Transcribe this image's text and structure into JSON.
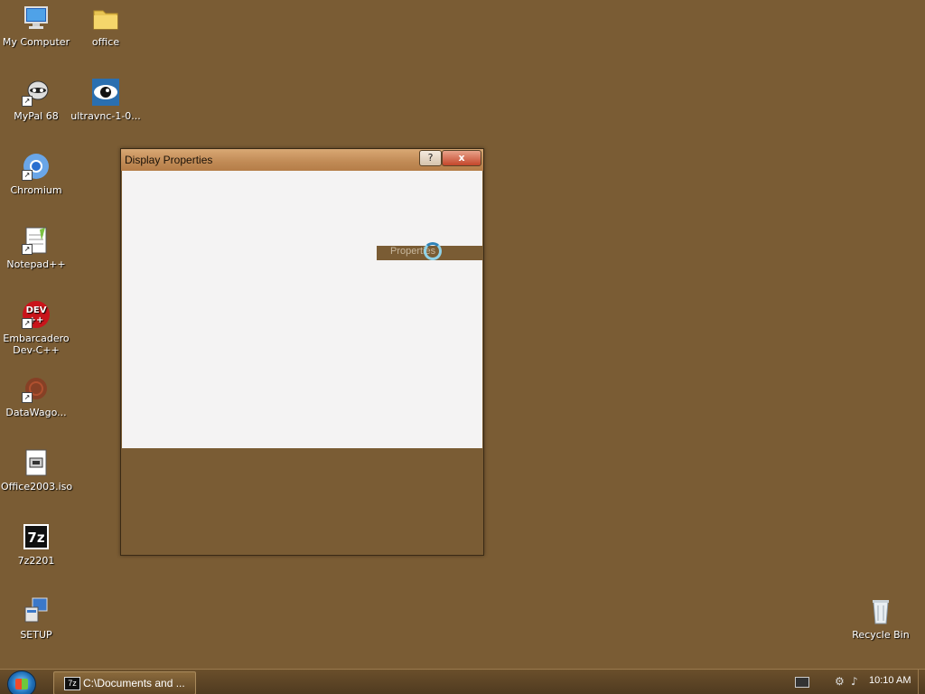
{
  "desktop": {
    "icons": [
      {
        "label": "My Computer",
        "icon": "computer-icon"
      },
      {
        "label": "office",
        "icon": "folder-icon"
      },
      {
        "label": "MyPal 68",
        "icon": "raccoon-browser-icon"
      },
      {
        "label": "ultravnc-1-0...",
        "icon": "eye-icon"
      },
      {
        "label": "Chromium",
        "icon": "chromium-icon"
      },
      {
        "label": "Notepad++",
        "icon": "notepad-plus-icon"
      },
      {
        "label": "Embarcadero Dev-C++",
        "icon": "devcpp-icon"
      },
      {
        "label": "DataWago...",
        "icon": "datawagon-icon"
      },
      {
        "label": "Office2003.iso",
        "icon": "iso-file-icon"
      },
      {
        "label": "7z2201",
        "icon": "sevenzip-icon"
      },
      {
        "label": "SETUP",
        "icon": "setup-icon"
      },
      {
        "label": "Recycle Bin",
        "icon": "recycle-bin-icon"
      }
    ]
  },
  "dialog": {
    "title": "Display Properties",
    "help_button": "?",
    "close_button": "x",
    "properties_label": "Properties"
  },
  "taskbar": {
    "task_icon_text": "7z",
    "task_label": "C:\\Documents and ...",
    "clock": "10:10 AM"
  }
}
